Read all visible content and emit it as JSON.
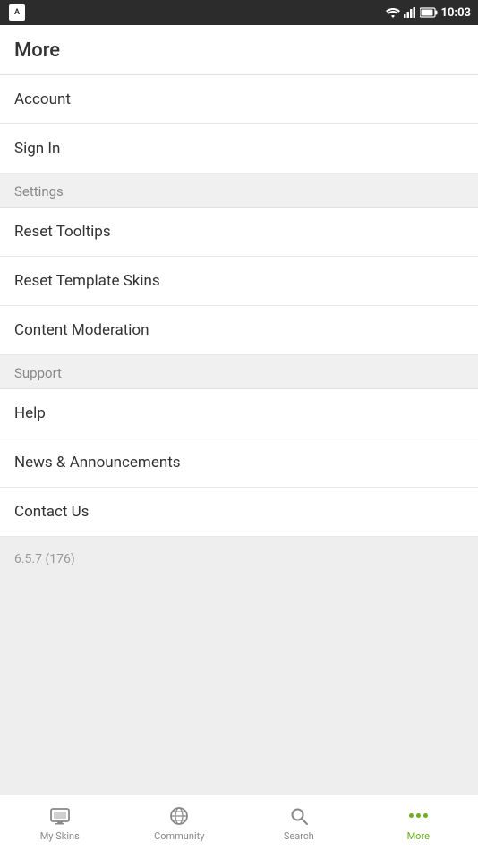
{
  "statusBar": {
    "time": "10:03",
    "appLogo": "A"
  },
  "pageTitle": "More",
  "menuItems": [
    {
      "id": "account",
      "label": "Account",
      "section": false
    },
    {
      "id": "sign-in",
      "label": "Sign In",
      "section": false
    },
    {
      "id": "settings-header",
      "label": "Settings",
      "section": true
    },
    {
      "id": "reset-tooltips",
      "label": "Reset Tooltips",
      "section": false
    },
    {
      "id": "reset-template-skins",
      "label": "Reset Template Skins",
      "section": false
    },
    {
      "id": "content-moderation",
      "label": "Content Moderation",
      "section": false
    },
    {
      "id": "support-header",
      "label": "Support",
      "section": true
    },
    {
      "id": "help",
      "label": "Help",
      "section": false
    },
    {
      "id": "news-announcements",
      "label": "News & Announcements",
      "section": false
    },
    {
      "id": "contact-us",
      "label": "Contact Us",
      "section": false
    }
  ],
  "version": "6.5.7 (176)",
  "bottomNav": {
    "items": [
      {
        "id": "my-skins",
        "label": "My Skins",
        "active": false
      },
      {
        "id": "community",
        "label": "Community",
        "active": false
      },
      {
        "id": "search",
        "label": "Search",
        "active": false
      },
      {
        "id": "more",
        "label": "More",
        "active": true
      }
    ]
  }
}
